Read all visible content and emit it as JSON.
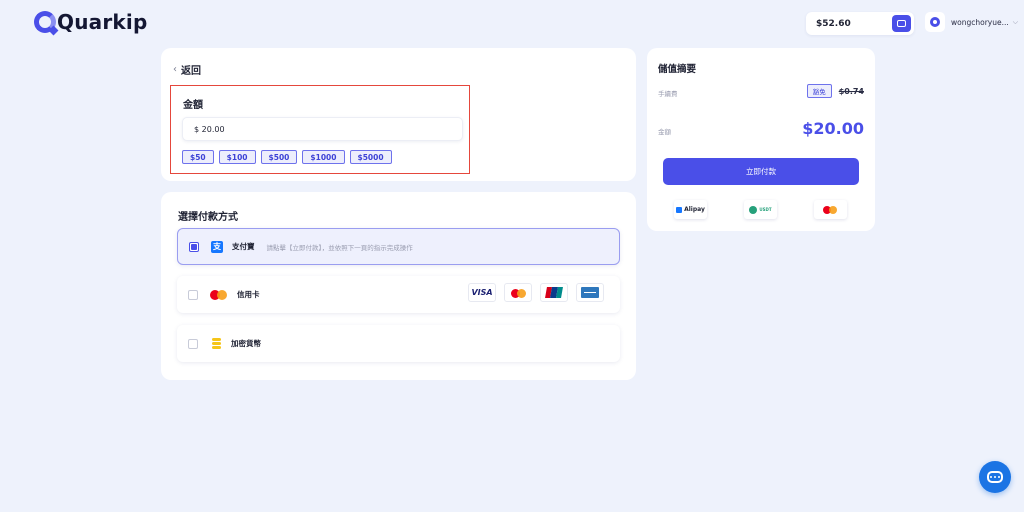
{
  "brand": {
    "name": "Quarkip",
    "accent": "#4a4fe8"
  },
  "header": {
    "balance": "$52.60",
    "username": "wongchoryue...",
    "wallet_icon": "wallet-icon"
  },
  "amount_card": {
    "back_label": "返回",
    "title": "金額",
    "input_value": "$ 20.00",
    "presets": [
      "$50",
      "$100",
      "$500",
      "$1000",
      "$5000"
    ]
  },
  "payment": {
    "title": "選擇付款方式",
    "options": [
      {
        "label": "支付寶",
        "desc": "請點擊【立即付款】，並依照下一頁的指示完成操作",
        "selected": true,
        "icon": "alipay-icon"
      },
      {
        "label": "信用卡",
        "selected": false,
        "icon": "mastercard-icon"
      },
      {
        "label": "加密貨幣",
        "selected": false,
        "icon": "coin-stack-icon"
      }
    ],
    "card_brands": [
      "VISA",
      "Mastercard",
      "UnionPay",
      "American Express"
    ]
  },
  "summary": {
    "title": "儲值摘要",
    "fee_label": "手續費",
    "fee_badge": "豁免",
    "fee_original": "$0.74",
    "amount_label": "金額",
    "amount_value": "$20.00",
    "pay_button": "立即付款",
    "method_logos": {
      "alipay": "Alipay",
      "usdt": "USDT"
    }
  }
}
